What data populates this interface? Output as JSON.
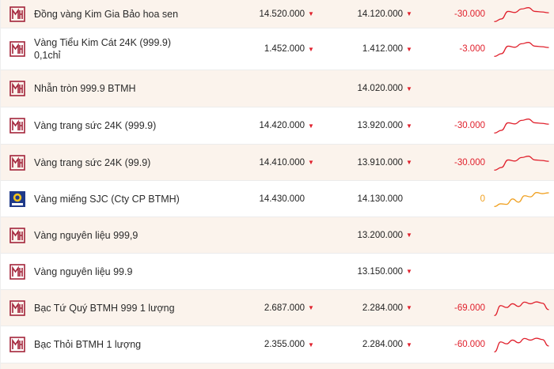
{
  "colors": {
    "row_tan": "#fbf3ec",
    "down_red": "#e0202c",
    "flat_orange": "#f0a020",
    "btmh_brand": "#a3243a",
    "sjc_blue": "#1f3a8a",
    "sjc_yellow": "#f3c31a"
  },
  "icons": {
    "down": "▼",
    "btmh_logo": "btmh-logo-icon",
    "sjc_logo": "sjc-logo-icon"
  },
  "rows": [
    {
      "name": "Đồng vàng Kim Gia Bảo hoa sen",
      "name2": "",
      "buy": "14.520.000",
      "buy_down": true,
      "sell": "14.120.000",
      "sell_down": true,
      "change": "-30.000",
      "trend": "down",
      "logo": "btmh",
      "spark": [
        6,
        5,
        2.2,
        2.6,
        1.3,
        0.8,
        2.2,
        2.4,
        2.7
      ]
    },
    {
      "name": "Vàng Tiểu Kim Cát 24K (999.9)",
      "name2": "0,1chỉ",
      "buy": "1.452.000",
      "buy_down": true,
      "sell": "1.412.000",
      "sell_down": true,
      "change": "-3.000",
      "trend": "down",
      "logo": "btmh",
      "spark": [
        6,
        5,
        2.2,
        2.6,
        1.3,
        0.8,
        2.2,
        2.4,
        2.7
      ]
    },
    {
      "name": "Nhẫn tròn 999.9 BTMH",
      "name2": "",
      "buy": "",
      "buy_down": false,
      "sell": "14.020.000",
      "sell_down": true,
      "change": "",
      "trend": "",
      "logo": "btmh",
      "spark": []
    },
    {
      "name": "Vàng trang sức 24K (999.9)",
      "name2": "",
      "buy": "14.420.000",
      "buy_down": true,
      "sell": "13.920.000",
      "sell_down": true,
      "change": "-30.000",
      "trend": "down",
      "logo": "btmh",
      "spark": [
        6,
        5,
        2.2,
        2.6,
        1.3,
        0.8,
        2.2,
        2.4,
        2.7
      ]
    },
    {
      "name": "Vàng trang sức 24K (99.9)",
      "name2": "",
      "buy": "14.410.000",
      "buy_down": true,
      "sell": "13.910.000",
      "sell_down": true,
      "change": "-30.000",
      "trend": "down",
      "logo": "btmh",
      "spark": [
        6,
        5,
        2.2,
        2.6,
        1.3,
        0.8,
        2.2,
        2.4,
        2.7
      ]
    },
    {
      "name": "Vàng miếng SJC (Cty CP BTMH)",
      "name2": "",
      "buy": "14.430.000",
      "buy_down": false,
      "sell": "14.130.000",
      "sell_down": false,
      "change": "0",
      "trend": "flat",
      "logo": "sjc",
      "spark": [
        6,
        5,
        5.2,
        3.2,
        4.4,
        2.0,
        2.4,
        0.8,
        1.2,
        0.9
      ]
    },
    {
      "name": "Vàng nguyên liệu 999,9",
      "name2": "",
      "buy": "",
      "buy_down": false,
      "sell": "13.200.000",
      "sell_down": true,
      "change": "",
      "trend": "",
      "logo": "btmh",
      "spark": []
    },
    {
      "name": "Vàng nguyên liệu 99.9",
      "name2": "",
      "buy": "",
      "buy_down": false,
      "sell": "13.150.000",
      "sell_down": true,
      "change": "",
      "trend": "",
      "logo": "btmh",
      "spark": []
    },
    {
      "name": "Bạc Tứ Quý BTMH 999 1 lượng",
      "name2": "",
      "buy": "2.687.000",
      "buy_down": true,
      "sell": "2.284.000",
      "sell_down": true,
      "change": "-69.000",
      "trend": "down",
      "logo": "btmh",
      "spark": [
        6,
        2.3,
        3.0,
        1.6,
        2.6,
        1.0,
        1.6,
        0.9,
        1.4,
        3.8
      ]
    },
    {
      "name": "Bạc Thỏi BTMH 1 lượng",
      "name2": "",
      "buy": "2.355.000",
      "buy_down": true,
      "sell": "2.284.000",
      "sell_down": true,
      "change": "-60.000",
      "trend": "down",
      "logo": "btmh",
      "spark": [
        6,
        2.3,
        3.0,
        1.6,
        2.6,
        1.0,
        1.6,
        0.9,
        1.4,
        3.8
      ]
    }
  ]
}
